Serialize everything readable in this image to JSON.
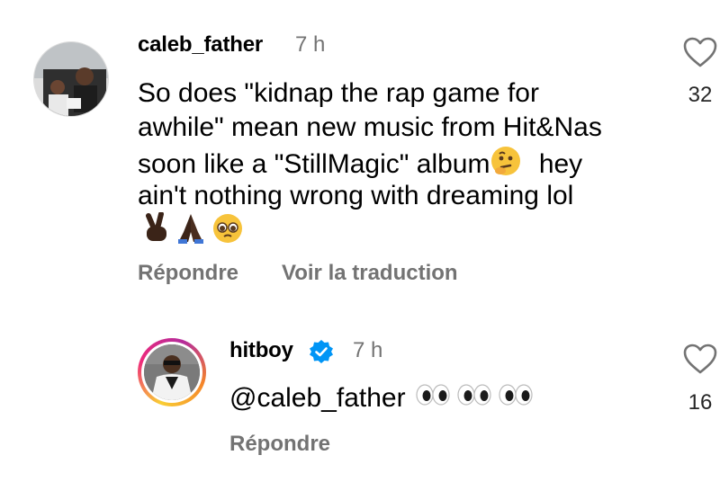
{
  "comments": [
    {
      "username": "caleb_father",
      "time": "7 h",
      "lines": [
        "So does \"kidnap the rap game for",
        "awhile\" mean new music from Hit&Nas",
        "soon like a \"StillMagic\" album",
        "ain't nothing wrong with dreaming lol"
      ],
      "line3_after_emoji": "hey",
      "emoji_row": [
        "victory-hand-dark",
        "folded-hands-dark",
        "pleading-face"
      ],
      "reply_label": "Répondre",
      "translate_label": "Voir la traduction",
      "like_count": "32"
    },
    {
      "username": "hitboy",
      "time": "7 h",
      "mention": "@caleb_father",
      "emojis": [
        "eyes",
        "eyes",
        "eyes"
      ],
      "reply_label": "Répondre",
      "like_count": "16"
    }
  ],
  "icons": {
    "like": "heart-outline-icon",
    "verified": "verified-badge-icon"
  },
  "colors": {
    "secondary_text": "#737373",
    "verified_blue": "#0095f6"
  }
}
